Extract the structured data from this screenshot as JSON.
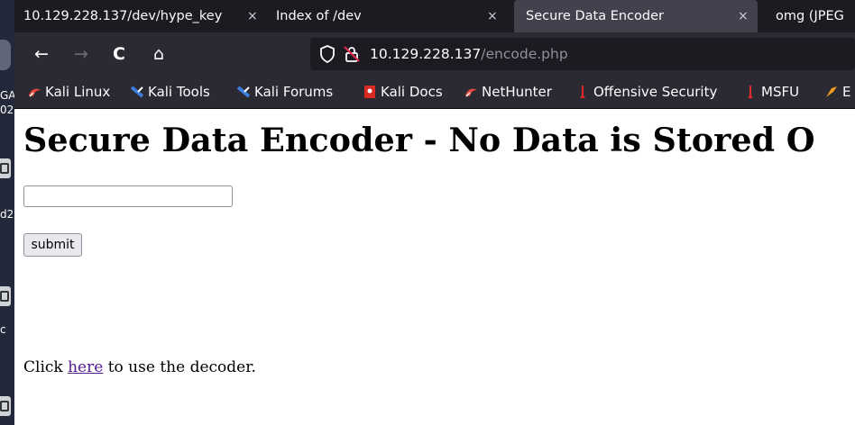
{
  "desktop": {
    "fragments": [
      "GA",
      "02",
      "d2",
      "c"
    ]
  },
  "tabs": [
    {
      "title": "10.129.228.137/dev/hype_key",
      "close": "×",
      "active": false
    },
    {
      "title": "Index of /dev",
      "close": "×",
      "active": false
    },
    {
      "title": "Secure Data Encoder",
      "close": "×",
      "active": true
    },
    {
      "title": "omg (JPEG",
      "close": "",
      "active": false
    }
  ],
  "nav": {
    "back": "←",
    "forward": "→",
    "reload": "C",
    "home": "⌂"
  },
  "url": {
    "host": "10.129.228.137",
    "path": "/encode.php"
  },
  "bookmarks": [
    {
      "label": "Kali Linux",
      "icon": "kali-dragon-icon",
      "color": "#e8473b"
    },
    {
      "label": "Kali Tools",
      "icon": "kali-tools-icon",
      "color": "#3b7ddd"
    },
    {
      "label": "Kali Forums",
      "icon": "kali-forums-icon",
      "color": "#3b7ddd"
    },
    {
      "label": "Kali Docs",
      "icon": "kali-docs-icon",
      "color": "#d82a20"
    },
    {
      "label": "NetHunter",
      "icon": "nethunter-icon",
      "color": "#e8473b"
    },
    {
      "label": "Offensive Security",
      "icon": "offsec-icon",
      "color": "#e0282b"
    },
    {
      "label": "MSFU",
      "icon": "msfu-icon",
      "color": "#e0282b"
    },
    {
      "label": "E",
      "icon": "exploit-db-icon",
      "color": "#f39a1f"
    }
  ],
  "page": {
    "heading": "Secure Data Encoder - No Data is Stored O",
    "input_value": "",
    "submit_label": "submit",
    "footer_prefix": "Click ",
    "footer_link": "here",
    "footer_suffix": " to use the decoder."
  }
}
